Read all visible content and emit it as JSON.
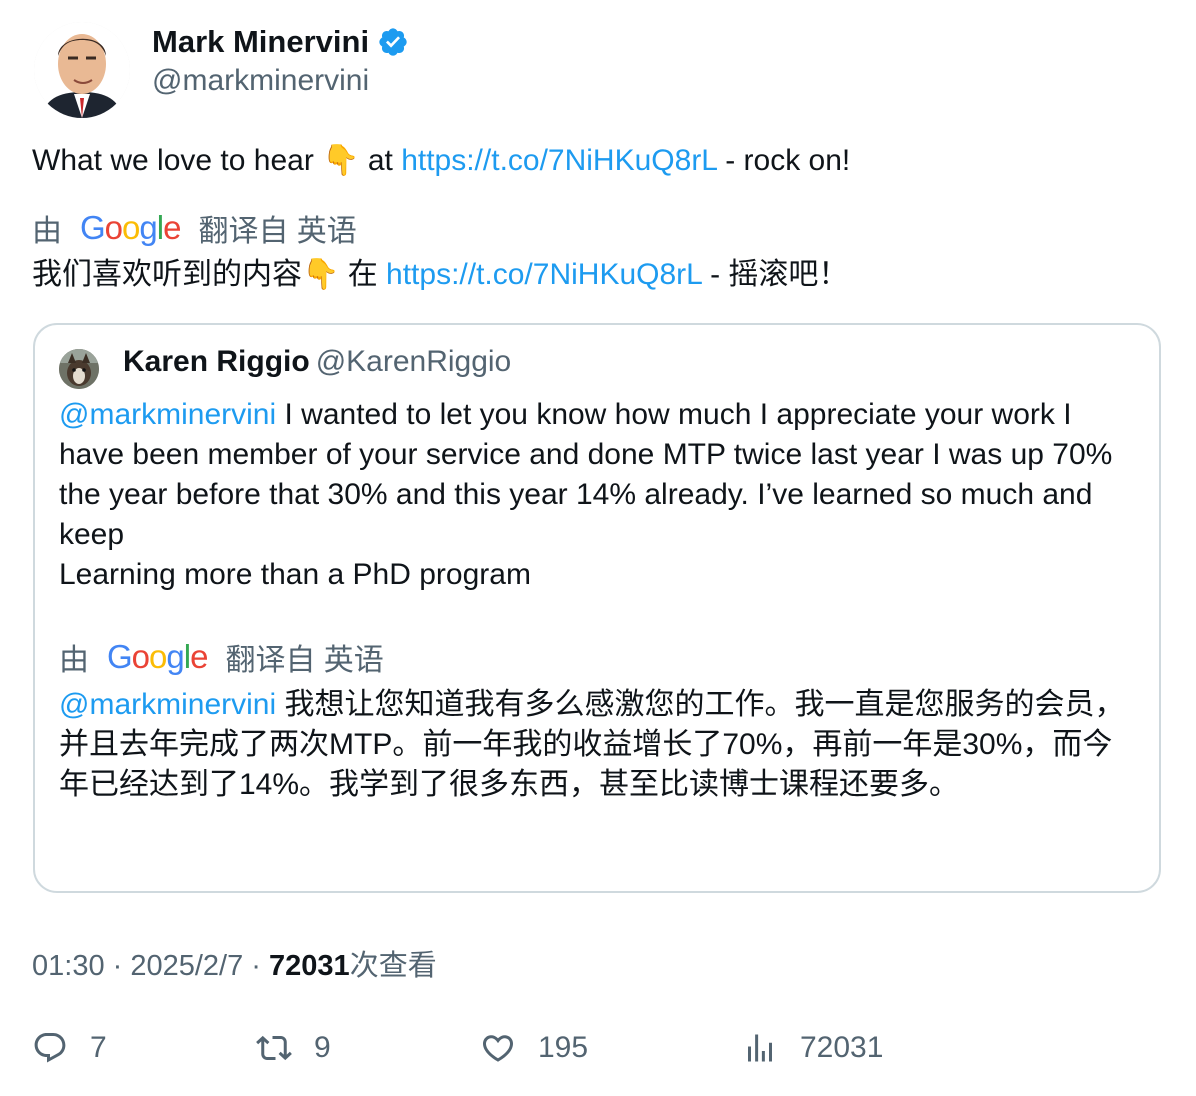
{
  "author": {
    "name": "Mark Minervini",
    "handle": "@markminervini",
    "verified_color": "#1d9bf0"
  },
  "tweet": {
    "text_before": "What we love to hear 👇 at ",
    "link": "https://t.co/7NiHKuQ8rL",
    "text_after": " - rock on!"
  },
  "translation_bar": {
    "by": "由",
    "provider": "Google",
    "from": "翻译自 英语"
  },
  "tweet_translated": {
    "text_before": "我们喜欢听到的内容👇 在 ",
    "link": "https://t.co/7NiHKuQ8rL",
    "text_after": " - 摇滚吧！"
  },
  "quote": {
    "name": "Karen Riggio",
    "handle": "@KarenRiggio",
    "mention": "@markminervini",
    "text_line1": " I wanted to let you know how much I appreciate your work I have been member of your service and done MTP twice last year I was up 70% the year before that 30% and this year 14% already. I’ve learned so much and keep",
    "text_line2": "Learning more than a PhD program",
    "translated_mention": "@markminervini",
    "translated_text": " 我想让您知道我有多么感激您的工作。我一直是您服务的会员，并且去年完成了两次MTP。前一年我的收益增长了70%，再前一年是30%，而今年已经达到了14%。我学到了很多东西，甚至比读博士课程还要多。"
  },
  "meta": {
    "time": "01:30",
    "separator": " · ",
    "date": "2025/2/7",
    "views_count": "72031",
    "views_label": "次查看"
  },
  "actions": {
    "replies": "7",
    "retweets": "9",
    "likes": "195",
    "views": "72031"
  }
}
